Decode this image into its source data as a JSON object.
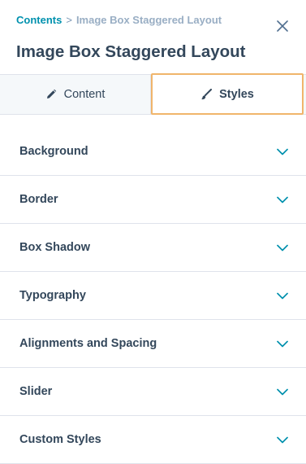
{
  "breadcrumb": {
    "link": "Contents",
    "separator": ">",
    "current": "Image Box Staggered Layout"
  },
  "title": "Image Box Staggered Layout",
  "tabs": [
    {
      "label": "Content",
      "icon": "pencil-icon",
      "active": false
    },
    {
      "label": "Styles",
      "icon": "brush-icon",
      "active": true
    }
  ],
  "sections": [
    {
      "label": "Background"
    },
    {
      "label": "Border"
    },
    {
      "label": "Box Shadow"
    },
    {
      "label": "Typography"
    },
    {
      "label": "Alignments and Spacing"
    },
    {
      "label": "Slider"
    },
    {
      "label": "Custom Styles"
    }
  ],
  "colors": {
    "link": "#0091ae",
    "text": "#33475b",
    "accent_focus": "#f0b56b",
    "chevron": "#0091ae"
  }
}
